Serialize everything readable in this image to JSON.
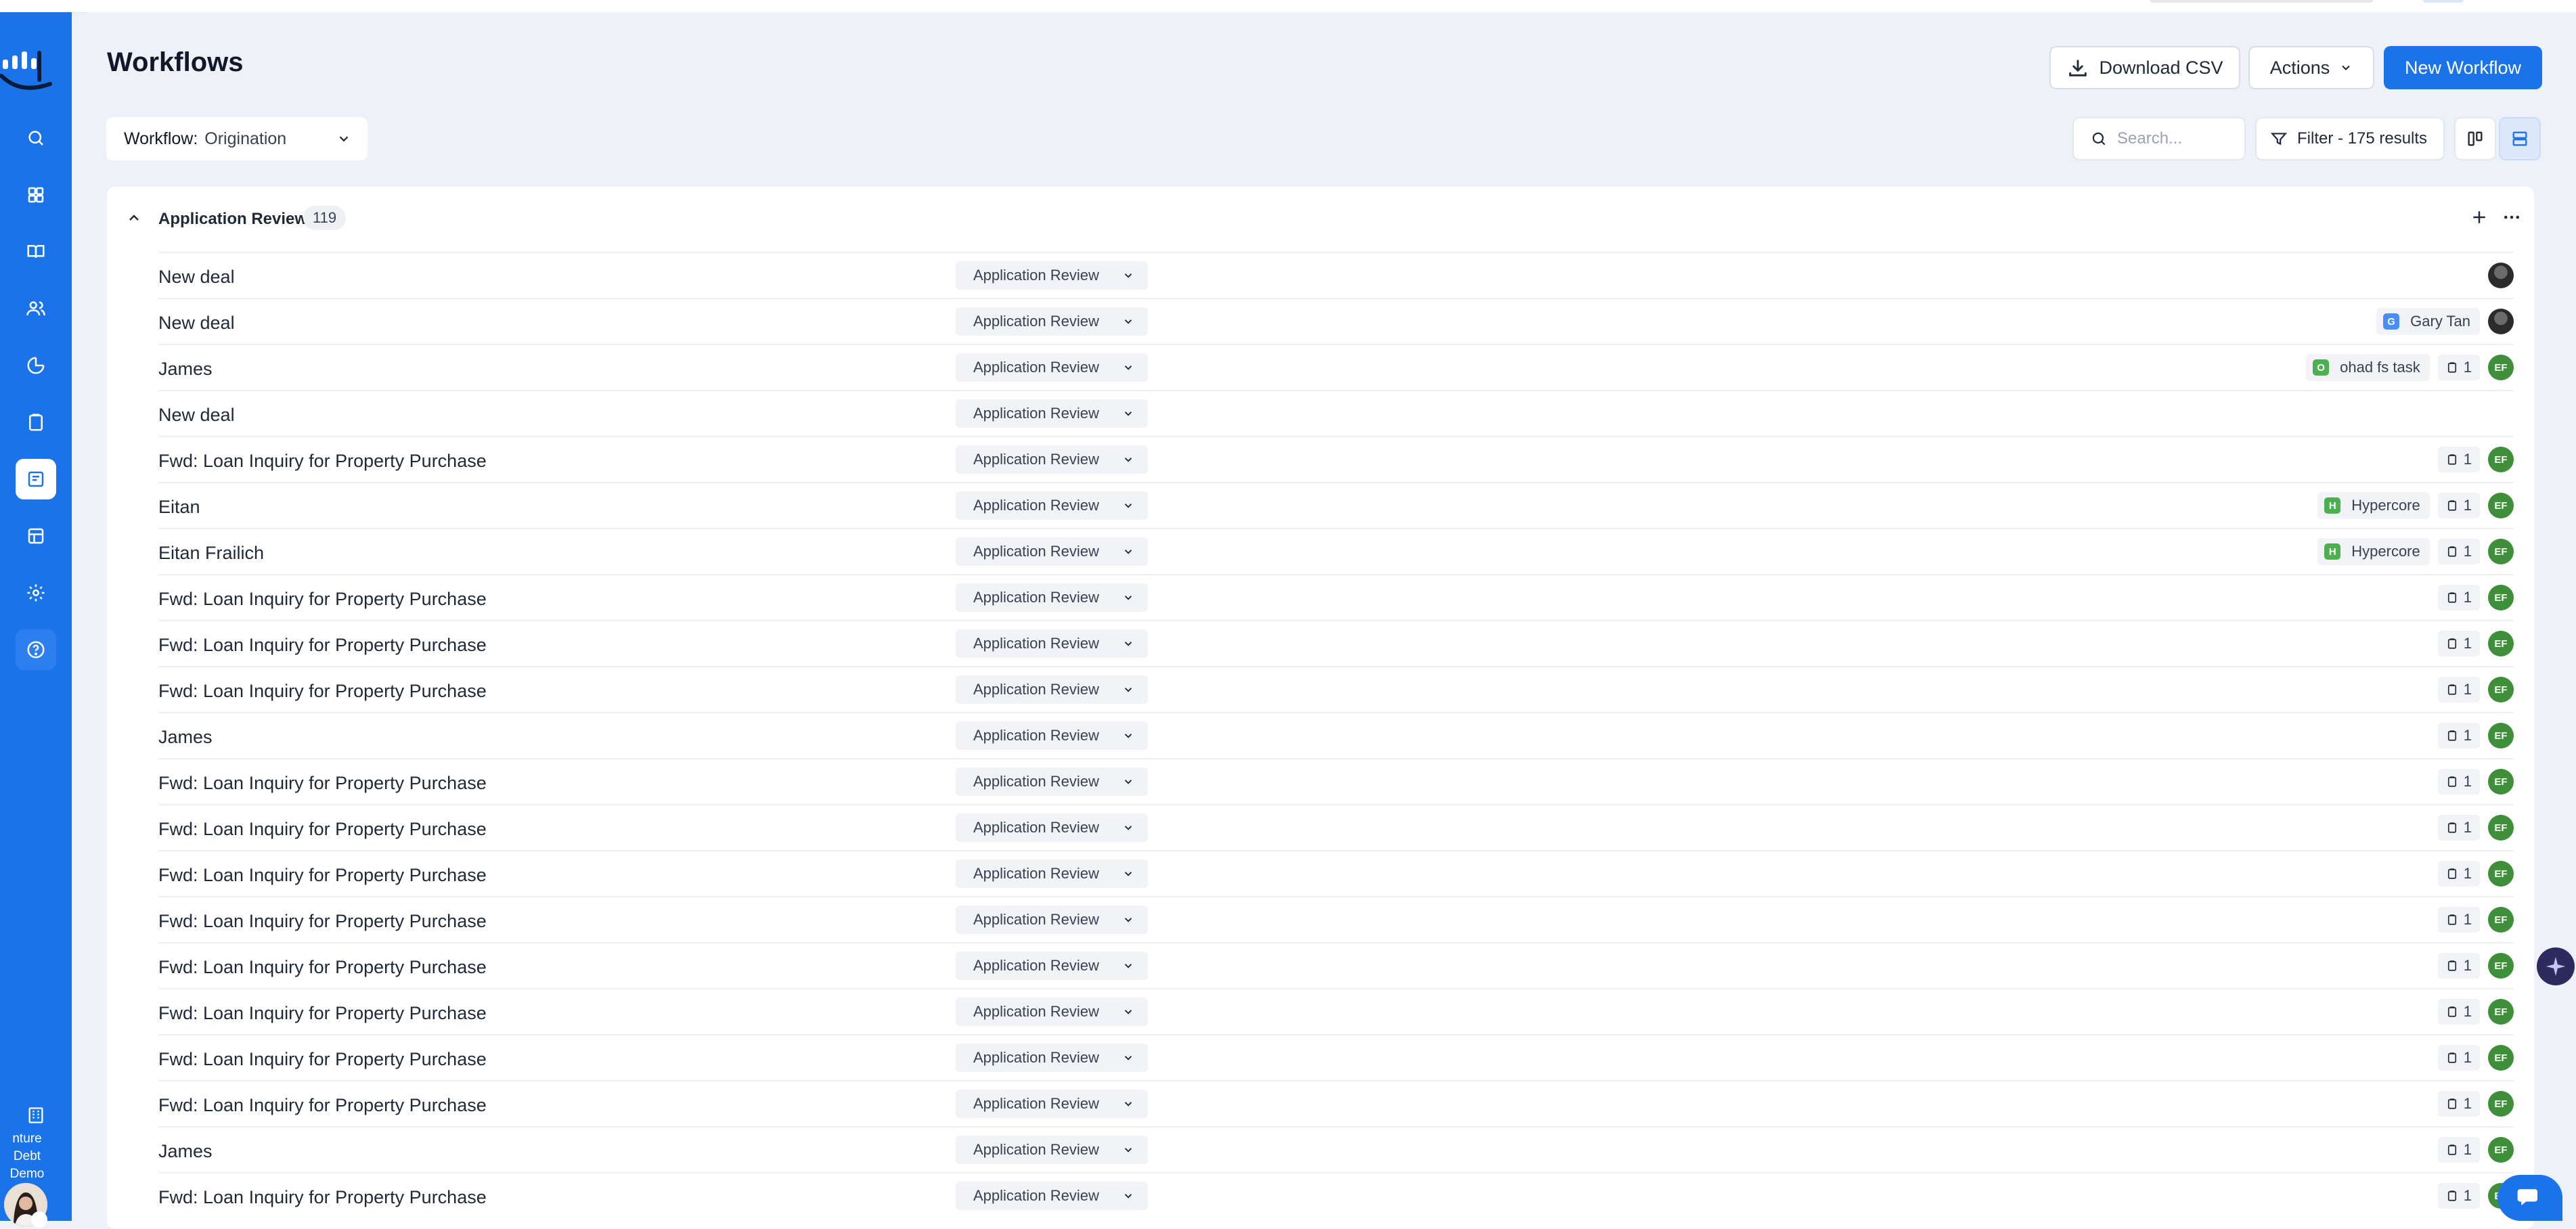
{
  "app": {
    "org_name": "Venture Debt Demo",
    "org_name_visible": "nture Debt Demo"
  },
  "page": {
    "title": "Workflows"
  },
  "toolbar": {
    "download_csv": "Download CSV",
    "actions": "Actions",
    "new_workflow": "New Workflow"
  },
  "workflow_select": {
    "label": "Workflow:",
    "value": "Origination"
  },
  "search": {
    "placeholder": "Search..."
  },
  "filter": {
    "label": "Filter - 175 results"
  },
  "sidebar_items": [
    "search-icon",
    "dashboard-icon",
    "book-icon",
    "contacts-icon",
    "analytics-icon",
    "clipboard-icon",
    "workflows-icon",
    "table-icon",
    "settings-icon",
    "help-icon"
  ],
  "group": {
    "title": "Application Review",
    "count": "119"
  },
  "rows": [
    {
      "title": "New deal",
      "stage": "Application Review",
      "company": null,
      "tasks": null,
      "avatar": "photo"
    },
    {
      "title": "New deal",
      "stage": "Application Review",
      "company": {
        "name": "Gary Tan",
        "initial": "G",
        "color": "#4a8df6"
      },
      "tasks": null,
      "avatar": "photo"
    },
    {
      "title": "James",
      "stage": "Application Review",
      "company": {
        "name": "ohad fs task",
        "initial": "O",
        "color": "#4caf50"
      },
      "tasks": "1",
      "avatar": "EF"
    },
    {
      "title": "New deal",
      "stage": "Application Review",
      "company": null,
      "tasks": null,
      "avatar": null
    },
    {
      "title": "Fwd: Loan Inquiry for Property Purchase",
      "stage": "Application Review",
      "company": null,
      "tasks": "1",
      "avatar": "EF"
    },
    {
      "title": "Eitan",
      "stage": "Application Review",
      "company": {
        "name": "Hypercore",
        "initial": "H",
        "color": "#4caf50"
      },
      "tasks": "1",
      "avatar": "EF"
    },
    {
      "title": "Eitan Frailich",
      "stage": "Application Review",
      "company": {
        "name": "Hypercore",
        "initial": "H",
        "color": "#4caf50"
      },
      "tasks": "1",
      "avatar": "EF"
    },
    {
      "title": "Fwd: Loan Inquiry for Property Purchase",
      "stage": "Application Review",
      "company": null,
      "tasks": "1",
      "avatar": "EF"
    },
    {
      "title": "Fwd: Loan Inquiry for Property Purchase",
      "stage": "Application Review",
      "company": null,
      "tasks": "1",
      "avatar": "EF"
    },
    {
      "title": "Fwd: Loan Inquiry for Property Purchase",
      "stage": "Application Review",
      "company": null,
      "tasks": "1",
      "avatar": "EF"
    },
    {
      "title": "James",
      "stage": "Application Review",
      "company": null,
      "tasks": "1",
      "avatar": "EF"
    },
    {
      "title": "Fwd: Loan Inquiry for Property Purchase",
      "stage": "Application Review",
      "company": null,
      "tasks": "1",
      "avatar": "EF"
    },
    {
      "title": "Fwd: Loan Inquiry for Property Purchase",
      "stage": "Application Review",
      "company": null,
      "tasks": "1",
      "avatar": "EF"
    },
    {
      "title": "Fwd: Loan Inquiry for Property Purchase",
      "stage": "Application Review",
      "company": null,
      "tasks": "1",
      "avatar": "EF"
    },
    {
      "title": "Fwd: Loan Inquiry for Property Purchase",
      "stage": "Application Review",
      "company": null,
      "tasks": "1",
      "avatar": "EF"
    },
    {
      "title": "Fwd: Loan Inquiry for Property Purchase",
      "stage": "Application Review",
      "company": null,
      "tasks": "1",
      "avatar": "EF"
    },
    {
      "title": "Fwd: Loan Inquiry for Property Purchase",
      "stage": "Application Review",
      "company": null,
      "tasks": "1",
      "avatar": "EF"
    },
    {
      "title": "Fwd: Loan Inquiry for Property Purchase",
      "stage": "Application Review",
      "company": null,
      "tasks": "1",
      "avatar": "EF"
    },
    {
      "title": "Fwd: Loan Inquiry for Property Purchase",
      "stage": "Application Review",
      "company": null,
      "tasks": "1",
      "avatar": "EF"
    },
    {
      "title": "James",
      "stage": "Application Review",
      "company": null,
      "tasks": "1",
      "avatar": "EF"
    },
    {
      "title": "Fwd: Loan Inquiry for Property Purchase",
      "stage": "Application Review",
      "company": null,
      "tasks": "1",
      "avatar": "EF"
    }
  ],
  "colors": {
    "brand": "#1a73e8",
    "avatar_green": "#3f8f3a"
  }
}
